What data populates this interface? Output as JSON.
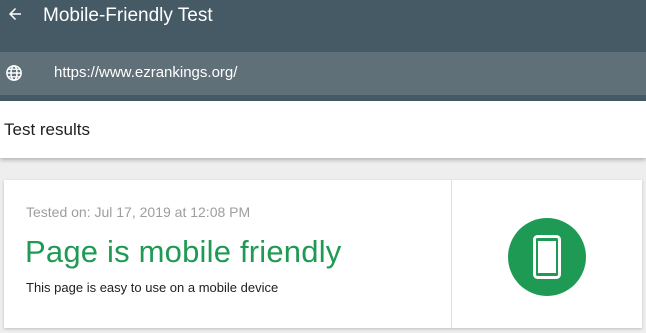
{
  "header": {
    "title": "Mobile-Friendly Test",
    "back_icon": "arrow-back-icon"
  },
  "url_bar": {
    "icon": "globe-icon",
    "url": "https://www.ezrankings.org/"
  },
  "results": {
    "heading": "Test results"
  },
  "result_card": {
    "tested_on": "Tested on: Jul 17, 2019 at 12:08 PM",
    "verdict": "Page is mobile friendly",
    "description": "This page is easy to use on a mobile device",
    "status_icon": "smartphone-icon",
    "status_color": "#1e9a55"
  },
  "colors": {
    "appbar": "#455a64",
    "urlbar": "#607079",
    "success": "#1e9a55"
  }
}
